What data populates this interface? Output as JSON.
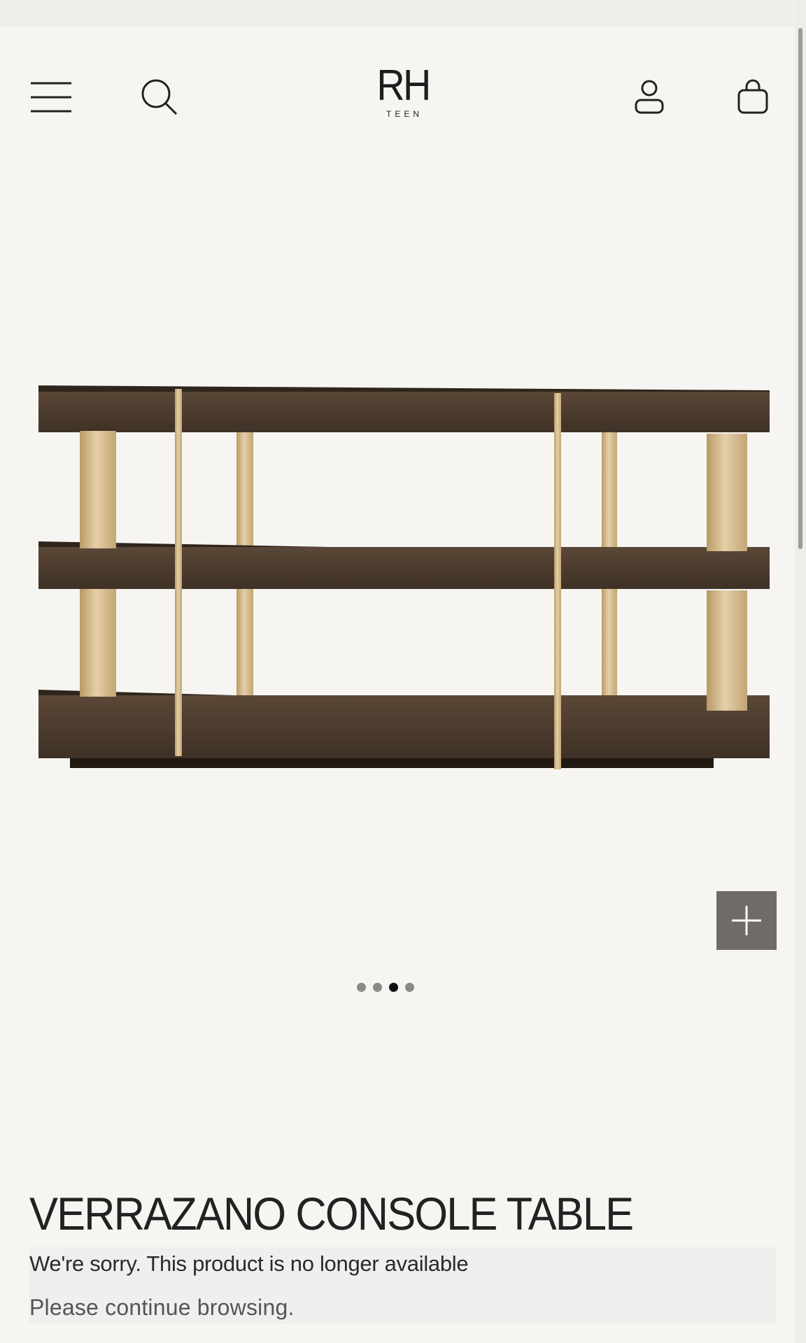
{
  "header": {
    "logo_mark": "RH",
    "logo_sub": "TEEN",
    "icons": {
      "menu": "hamburger-menu-icon",
      "search": "search-icon",
      "account": "account-icon",
      "cart": "shopping-bag-icon"
    }
  },
  "gallery": {
    "image_count": 4,
    "active_index": 2,
    "zoom_icon": "plus-icon"
  },
  "product": {
    "title": "VERRAZANO CONSOLE TABLE",
    "notice_line1": "We're sorry. This product is no longer available",
    "notice_line2": "Please continue browsing."
  },
  "colors": {
    "background": "#f6f5f2",
    "wood": "#4a3a2d",
    "brass": "#cdb48a",
    "zoom_button": "#6e6b68",
    "notice_bg": "#efefee"
  }
}
